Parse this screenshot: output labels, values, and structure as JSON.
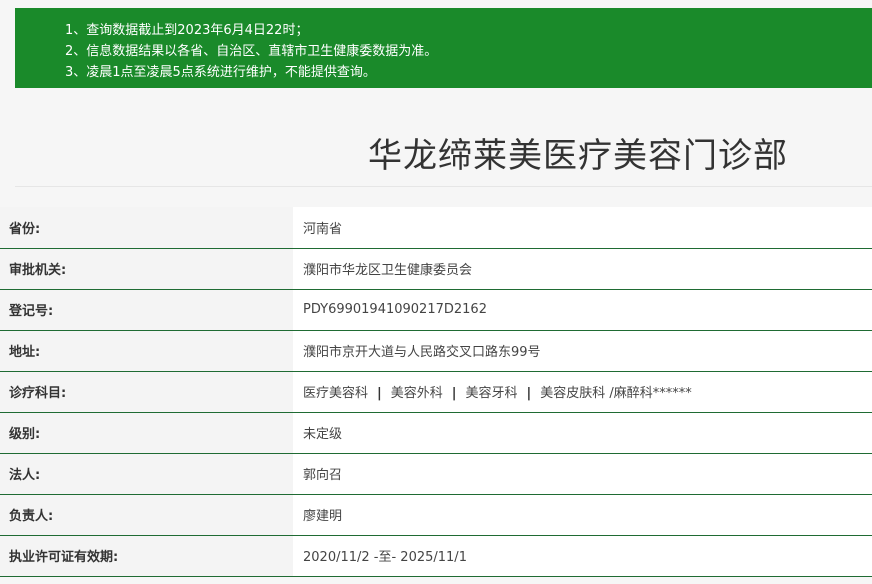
{
  "notice": {
    "items": [
      "1、查询数据截止到2023年6月4日22时；",
      "2、信息数据结果以各省、自治区、直辖市卫生健康委数据为准。",
      "3、凌晨1点至凌晨5点系统进行维护，不能提供查询。"
    ]
  },
  "title": "华龙缔莱美医疗美容门诊部",
  "info": {
    "province": {
      "label": "省份:",
      "value": "河南省"
    },
    "authority": {
      "label": "审批机关:",
      "value": "濮阳市华龙区卫生健康委员会"
    },
    "registration": {
      "label": "登记号:",
      "value": "PDY69901941090217D2162"
    },
    "address": {
      "label": "地址:",
      "value": "濮阳市京开大道与人民路交叉口路东99号"
    },
    "subjects": {
      "label": "诊疗科目:",
      "items": [
        "医疗美容科",
        "美容外科",
        "美容牙科",
        "美容皮肤科 /麻醉科******"
      ],
      "separator": "|"
    },
    "level": {
      "label": "级别:",
      "value": "未定级"
    },
    "legal_person": {
      "label": "法人:",
      "value": "郭向召"
    },
    "principal": {
      "label": "负责人:",
      "value": "廖建明"
    },
    "validity": {
      "label": "执业许可证有效期:",
      "value": "2020/11/2 -至- 2025/11/1"
    }
  },
  "colors": {
    "banner": "#1a8a2a",
    "row_border": "#1f6b33"
  }
}
